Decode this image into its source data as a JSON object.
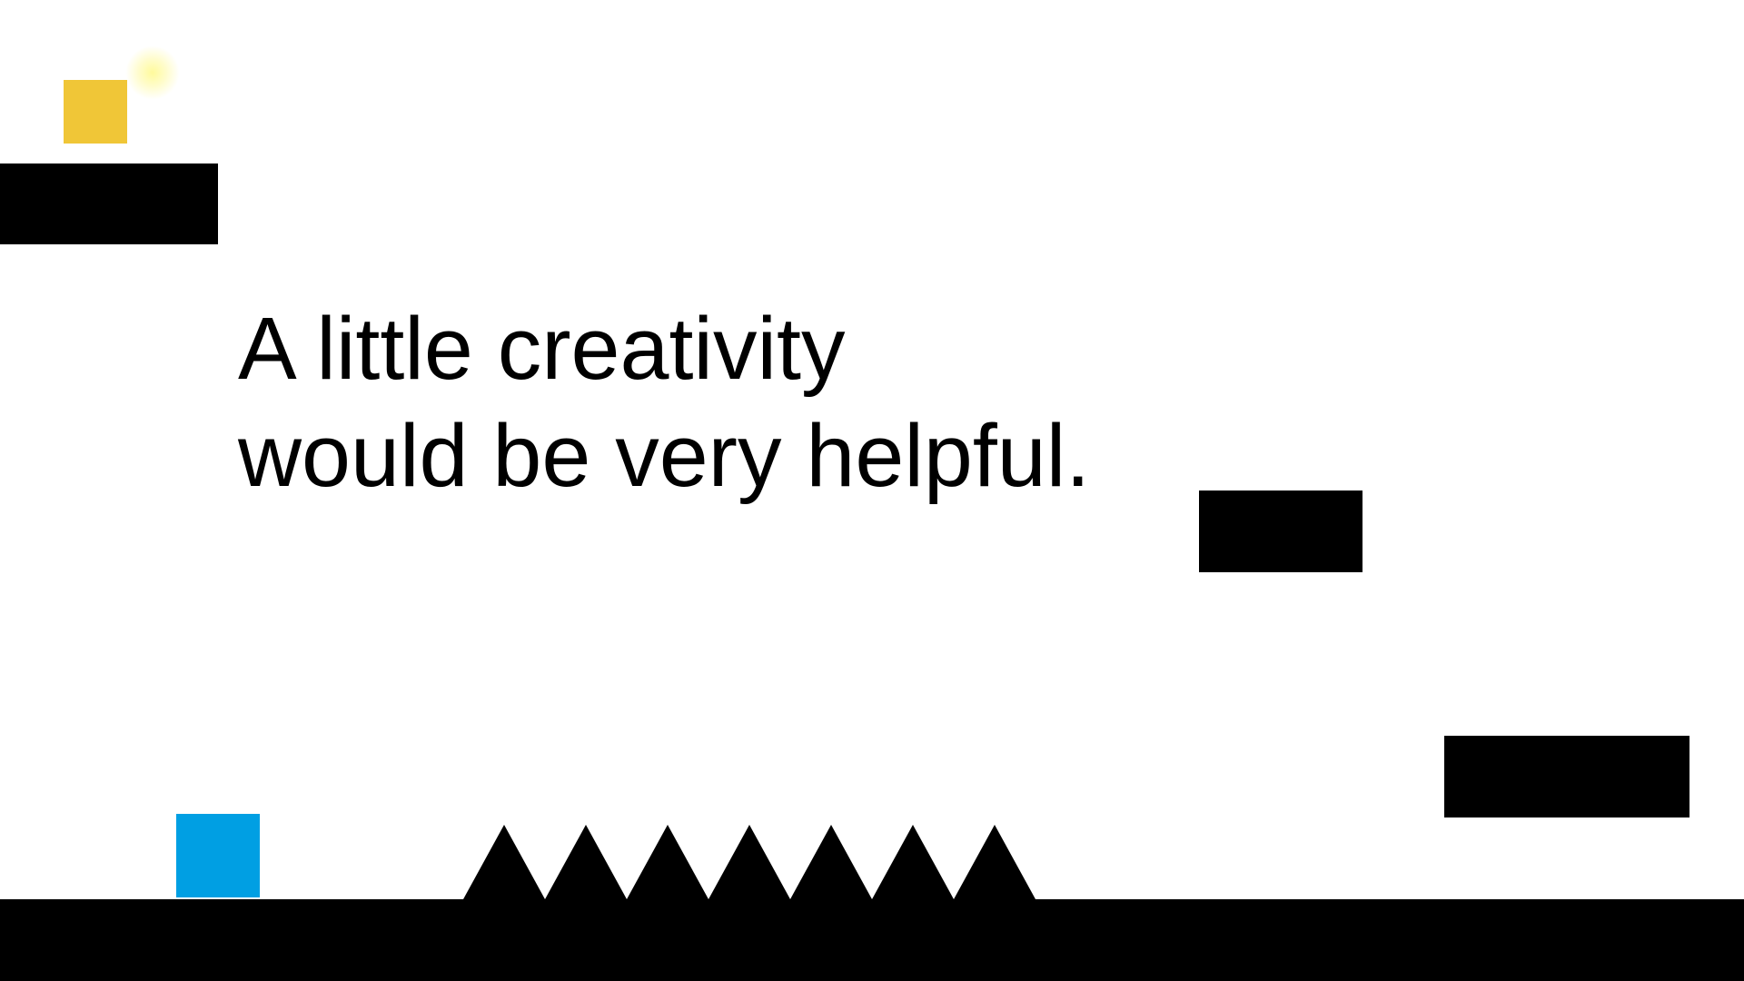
{
  "level": {
    "hint_lines": [
      "A little creativity",
      "would be very helpful."
    ]
  },
  "entities": {
    "goal": {
      "name": "goal-block",
      "color": "#F0C637",
      "glow_color": "#FFF9A0"
    },
    "player": {
      "name": "player-block",
      "color": "#009FE3"
    },
    "spikes": {
      "count": 7,
      "color": "#000000"
    }
  },
  "colors": {
    "background": "#FFFFFF",
    "terrain": "#000000"
  }
}
